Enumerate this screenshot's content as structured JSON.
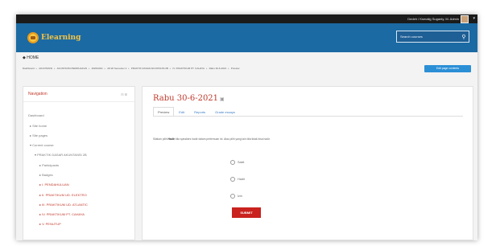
{
  "topbar": {
    "user_text": "Dedeh / Ksmalig Suganty, M.  Admin"
  },
  "header": {
    "logo_text": "Elearning",
    "search_placeholder": "Search courses"
  },
  "home_label": "◆ HOME",
  "breadcrumbs": [
    "Dashboard",
    "AKUNTANSI",
    "AKUNTANSI PERPAJAKAN",
    "2020/2021",
    "AP.20 Semester 2",
    "PRAKTIK DASAR AKUNTANSI 2B",
    "IV. PRAKTIKUM PT. CAHAYA",
    "Rabu 30-6-2021",
    "Preview"
  ],
  "edit_button": "Edit page contents",
  "sidebar": {
    "title": "Navigation",
    "tools": "⊟⊞",
    "items": [
      {
        "label": "Dashboard",
        "link": false
      },
      {
        "label": "▸ Site home",
        "link": false
      },
      {
        "label": "▸ Site pages",
        "link": false
      },
      {
        "label": "▾ Current course",
        "link": false
      },
      {
        "label": "▾ PRAKTIK DASAR AKUNTANSI 2B",
        "link": false
      },
      {
        "label": "▸ Participants",
        "link": false
      },
      {
        "label": "▸ Badges",
        "link": false
      },
      {
        "label": "▸ I. PENDAHULUAN",
        "link": true
      },
      {
        "label": "▸ II. PRAKTIKUM UD. ELEKTRO",
        "link": true
      },
      {
        "label": "▸ III. PRAKTIKUM UD. ATLANTIC",
        "link": true
      },
      {
        "label": "▸ IV. PRAKTIKUM PT. CAHAYA",
        "link": true
      },
      {
        "label": "▸ V. PENUTUP",
        "link": true
      }
    ]
  },
  "main": {
    "title": "Rabu 30-6-2021",
    "tabs": [
      "Preview",
      "Edit",
      "Reports",
      "Grade essays"
    ],
    "question_prefix": "Silakan pilih ",
    "question_bold": "Hadir",
    "question_suffix": " bila speakers hadir dalam pertemuan ini. Atau pilih yang lain bila tidak bisa hadir.",
    "options": [
      "Sakit",
      "Hadir",
      "Izin"
    ],
    "submit": "SUBMIT"
  },
  "colors": {
    "header": "#1b6aa3",
    "accent": "#c0392b",
    "button": "#2b8fd6",
    "submit": "#c9221f"
  }
}
